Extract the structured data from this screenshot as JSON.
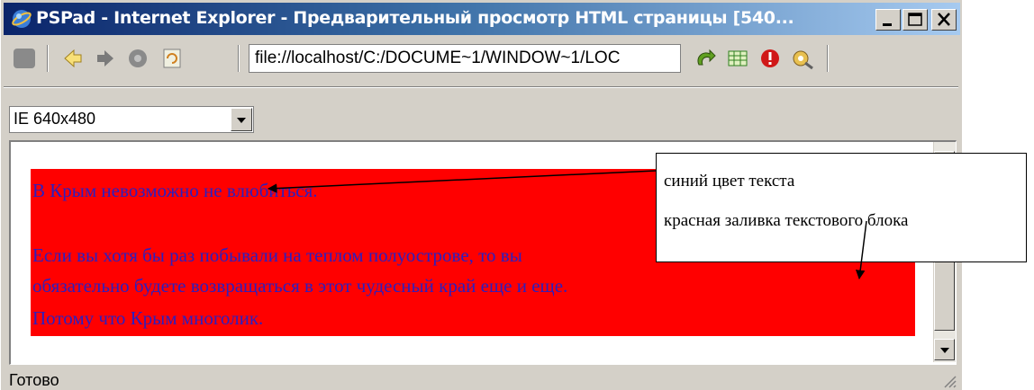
{
  "window": {
    "title": "PSPad - Internet Explorer - Предварительный просмотр HTML страницы  [540...",
    "minimize_icon": "minimize-icon",
    "maximize_icon": "maximize-icon",
    "close_icon": "close-icon"
  },
  "toolbar": {
    "address": "file://localhost/C:/DOCUME~1/WINDOW~1/LOC",
    "icons": [
      "stop-icon",
      "back-icon",
      "forward-icon",
      "home-icon",
      "refresh-icon",
      "go-icon",
      "table-icon",
      "alert-icon",
      "settings-icon"
    ]
  },
  "viewer": {
    "size_select": "IE 640x480"
  },
  "content": {
    "line1": "В Крым невозможно не влюбиться.",
    "line2": "Если вы хотя бы раз побывали на теплом полуострове, то вы",
    "line3": "обязательно будете возвращаться в этот чудесный край еще и еще.",
    "line4": "Потому что Крым многолик.",
    "text_color": "#2b1fc0",
    "block_color": "#ff0000"
  },
  "status": {
    "text": "Готово"
  },
  "callout": {
    "label1": "синий цвет текста",
    "label2": "красная заливка текстового блока"
  }
}
